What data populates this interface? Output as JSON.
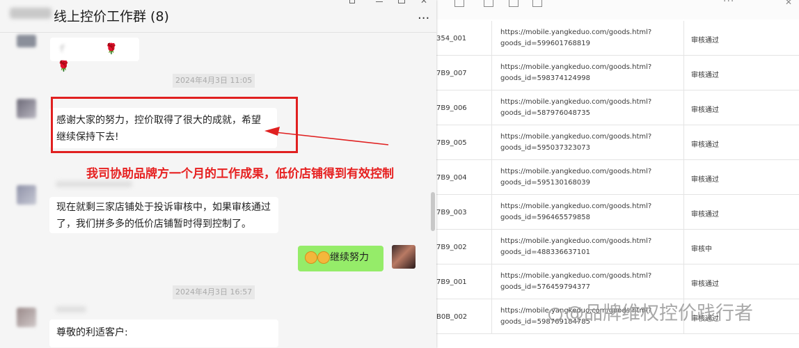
{
  "chat": {
    "title": "线上控价工作群 (8)",
    "more": "···",
    "messages": [
      {
        "text": "感谢大家的努力，控价取得了很大的成就，希望继续保持下去!"
      },
      {
        "text": "现在就剩三家店铺处于投诉审核中，如果审核通过了，我们拼多多的低价店铺暂时得到控制了。"
      },
      {
        "text": "尊敬的利适客户:"
      }
    ],
    "first_msg_roses": "🌹 🌹",
    "first_msg_partial": "ｆ",
    "times": [
      "2024年4月3日 11:05",
      "2024年4月3日 16:57"
    ],
    "self_message": "继续努力"
  },
  "annotation": {
    "text": "我司协助品牌方一个月的工作成果，低价店铺得到有效控制",
    "color": "#e62020"
  },
  "sheet": {
    "rows": [
      {
        "id": "354_001",
        "url1": "https://mobile.yangkeduo.com/goods.html?",
        "url2": "goods_id=599601768819",
        "status": "审核通过"
      },
      {
        "id": "7B9_007",
        "url1": "https://mobile.yangkeduo.com/goods.html?",
        "url2": "goods_id=598374124998",
        "status": "审核通过"
      },
      {
        "id": "7B9_006",
        "url1": "https://mobile.yangkeduo.com/goods.html?",
        "url2": "goods_id=587976048735",
        "status": "审核通过"
      },
      {
        "id": "7B9_005",
        "url1": "https://mobile.yangkeduo.com/goods.html?",
        "url2": "goods_id=595037323073",
        "status": "审核通过"
      },
      {
        "id": "7B9_004",
        "url1": "https://mobile.yangkeduo.com/goods.html?",
        "url2": "goods_id=595130168039",
        "status": "审核通过"
      },
      {
        "id": "7B9_003",
        "url1": "https://mobile.yangkeduo.com/goods.html?",
        "url2": "goods_id=596465579858",
        "status": "审核通过"
      },
      {
        "id": "7B9_002",
        "url1": "https://mobile.yangkeduo.com/goods.html?",
        "url2": "goods_id=488336637101",
        "status": "审核中"
      },
      {
        "id": "7B9_001",
        "url1": "https://mobile.yangkeduo.com/goods.html?",
        "url2": "goods_id=576459794377",
        "status": "审核通过"
      },
      {
        "id": "B0B_002",
        "url1": "https://mobile.yangkeduo.com/goods.html?",
        "url2": "goods_id=598769184785",
        "status": "审核通过"
      }
    ]
  },
  "watermark": "@品牌维权控价践行者",
  "colors": {
    "accent_red": "#e02020",
    "self_bubble": "#95ec69",
    "chat_bg": "#f5f5f5"
  }
}
